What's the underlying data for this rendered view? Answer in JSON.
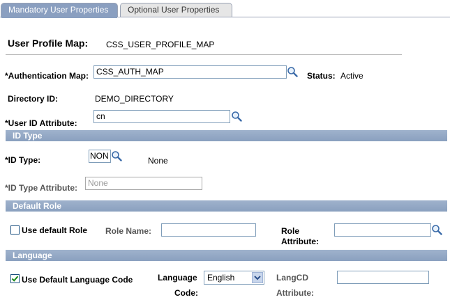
{
  "tabs": [
    {
      "label": "Mandatory User Properties",
      "active": true
    },
    {
      "label": "Optional User Properties",
      "active": false
    }
  ],
  "header": {
    "label": "User Profile Map:",
    "value": "CSS_USER_PROFILE_MAP"
  },
  "auth_map": {
    "label": "*Authentication Map:",
    "value": "CSS_AUTH_MAP"
  },
  "status": {
    "label": "Status:",
    "value": "Active"
  },
  "directory": {
    "label": "Directory ID:",
    "value": "DEMO_DIRECTORY"
  },
  "user_id_attr": {
    "label": "*User ID Attribute:",
    "value": "cn"
  },
  "id_type_section": {
    "title": "ID Type",
    "id_type_label": "*ID Type:",
    "id_type_value": "NON",
    "id_type_desc": "None",
    "id_type_attr_label": "*ID Type Attribute:",
    "id_type_attr_value": "None"
  },
  "default_role_section": {
    "title": "Default Role",
    "use_default_label": "Use default Role",
    "use_default_checked": false,
    "role_name_label": "Role Name:",
    "role_name_value": "",
    "role_attr_label_1": "Role",
    "role_attr_label_2": "Attribute:",
    "role_attr_value": ""
  },
  "language_section": {
    "title": "Language",
    "use_default_label": "Use Default Language Code",
    "use_default_checked": true,
    "lang_code_label_1": "Language",
    "lang_code_label_2": "Code:",
    "lang_code_value": "English",
    "langcd_attr_label_1": "LangCD",
    "langcd_attr_label_2": "Attribute:",
    "langcd_attr_value": ""
  },
  "colors": {
    "tab_active": "#8a9fc0",
    "section_header": "#8aa0bf",
    "check_blue": "#1c5180"
  }
}
